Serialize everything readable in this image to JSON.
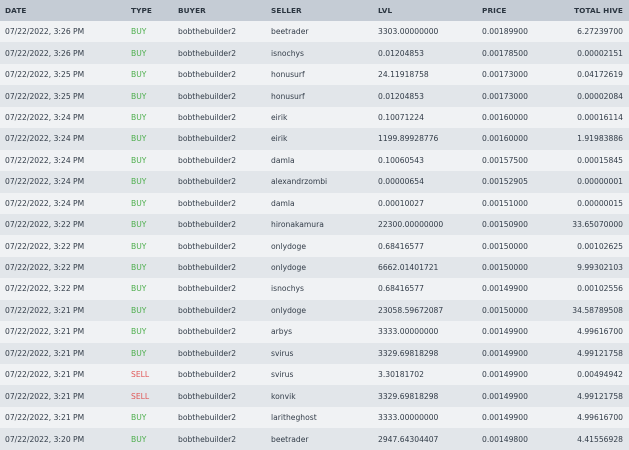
{
  "columns": {
    "date": "DATE",
    "type": "TYPE",
    "buyer": "BUYER",
    "seller": "SELLER",
    "lvl": "LVL",
    "price": "PRICE",
    "total": "TOTAL HIVE"
  },
  "colors": {
    "buy": "#4cae4c",
    "sell": "#e05858",
    "header_bg": "#c5ccd5",
    "row_odd_bg": "#f0f2f4",
    "row_even_bg": "#e2e6ea"
  },
  "rows": [
    {
      "date": "07/22/2022, 3:26 PM",
      "type": "BUY",
      "buyer": "bobthebuilder2",
      "seller": "beetrader",
      "lvl": "3303.00000000",
      "price": "0.00189900",
      "total": "6.27239700"
    },
    {
      "date": "07/22/2022, 3:26 PM",
      "type": "BUY",
      "buyer": "bobthebuilder2",
      "seller": "isnochys",
      "lvl": "0.01204853",
      "price": "0.00178500",
      "total": "0.00002151"
    },
    {
      "date": "07/22/2022, 3:25 PM",
      "type": "BUY",
      "buyer": "bobthebuilder2",
      "seller": "honusurf",
      "lvl": "24.11918758",
      "price": "0.00173000",
      "total": "0.04172619"
    },
    {
      "date": "07/22/2022, 3:25 PM",
      "type": "BUY",
      "buyer": "bobthebuilder2",
      "seller": "honusurf",
      "lvl": "0.01204853",
      "price": "0.00173000",
      "total": "0.00002084"
    },
    {
      "date": "07/22/2022, 3:24 PM",
      "type": "BUY",
      "buyer": "bobthebuilder2",
      "seller": "eirik",
      "lvl": "0.10071224",
      "price": "0.00160000",
      "total": "0.00016114"
    },
    {
      "date": "07/22/2022, 3:24 PM",
      "type": "BUY",
      "buyer": "bobthebuilder2",
      "seller": "eirik",
      "lvl": "1199.89928776",
      "price": "0.00160000",
      "total": "1.91983886"
    },
    {
      "date": "07/22/2022, 3:24 PM",
      "type": "BUY",
      "buyer": "bobthebuilder2",
      "seller": "damla",
      "lvl": "0.10060543",
      "price": "0.00157500",
      "total": "0.00015845"
    },
    {
      "date": "07/22/2022, 3:24 PM",
      "type": "BUY",
      "buyer": "bobthebuilder2",
      "seller": "alexandrzombi",
      "lvl": "0.00000654",
      "price": "0.00152905",
      "total": "0.00000001"
    },
    {
      "date": "07/22/2022, 3:24 PM",
      "type": "BUY",
      "buyer": "bobthebuilder2",
      "seller": "damla",
      "lvl": "0.00010027",
      "price": "0.00151000",
      "total": "0.00000015"
    },
    {
      "date": "07/22/2022, 3:22 PM",
      "type": "BUY",
      "buyer": "bobthebuilder2",
      "seller": "hironakamura",
      "lvl": "22300.00000000",
      "price": "0.00150900",
      "total": "33.65070000"
    },
    {
      "date": "07/22/2022, 3:22 PM",
      "type": "BUY",
      "buyer": "bobthebuilder2",
      "seller": "onlydoge",
      "lvl": "0.68416577",
      "price": "0.00150000",
      "total": "0.00102625"
    },
    {
      "date": "07/22/2022, 3:22 PM",
      "type": "BUY",
      "buyer": "bobthebuilder2",
      "seller": "onlydoge",
      "lvl": "6662.01401721",
      "price": "0.00150000",
      "total": "9.99302103"
    },
    {
      "date": "07/22/2022, 3:22 PM",
      "type": "BUY",
      "buyer": "bobthebuilder2",
      "seller": "isnochys",
      "lvl": "0.68416577",
      "price": "0.00149900",
      "total": "0.00102556"
    },
    {
      "date": "07/22/2022, 3:21 PM",
      "type": "BUY",
      "buyer": "bobthebuilder2",
      "seller": "onlydoge",
      "lvl": "23058.59672087",
      "price": "0.00150000",
      "total": "34.58789508"
    },
    {
      "date": "07/22/2022, 3:21 PM",
      "type": "BUY",
      "buyer": "bobthebuilder2",
      "seller": "arbys",
      "lvl": "3333.00000000",
      "price": "0.00149900",
      "total": "4.99616700"
    },
    {
      "date": "07/22/2022, 3:21 PM",
      "type": "BUY",
      "buyer": "bobthebuilder2",
      "seller": "svirus",
      "lvl": "3329.69818298",
      "price": "0.00149900",
      "total": "4.99121758"
    },
    {
      "date": "07/22/2022, 3:21 PM",
      "type": "SELL",
      "buyer": "bobthebuilder2",
      "seller": "svirus",
      "lvl": "3.30181702",
      "price": "0.00149900",
      "total": "0.00494942"
    },
    {
      "date": "07/22/2022, 3:21 PM",
      "type": "SELL",
      "buyer": "bobthebuilder2",
      "seller": "konvik",
      "lvl": "3329.69818298",
      "price": "0.00149900",
      "total": "4.99121758"
    },
    {
      "date": "07/22/2022, 3:21 PM",
      "type": "BUY",
      "buyer": "bobthebuilder2",
      "seller": "laritheghost",
      "lvl": "3333.00000000",
      "price": "0.00149900",
      "total": "4.99616700"
    },
    {
      "date": "07/22/2022, 3:20 PM",
      "type": "BUY",
      "buyer": "bobthebuilder2",
      "seller": "beetrader",
      "lvl": "2947.64304407",
      "price": "0.00149800",
      "total": "4.41556928"
    }
  ]
}
